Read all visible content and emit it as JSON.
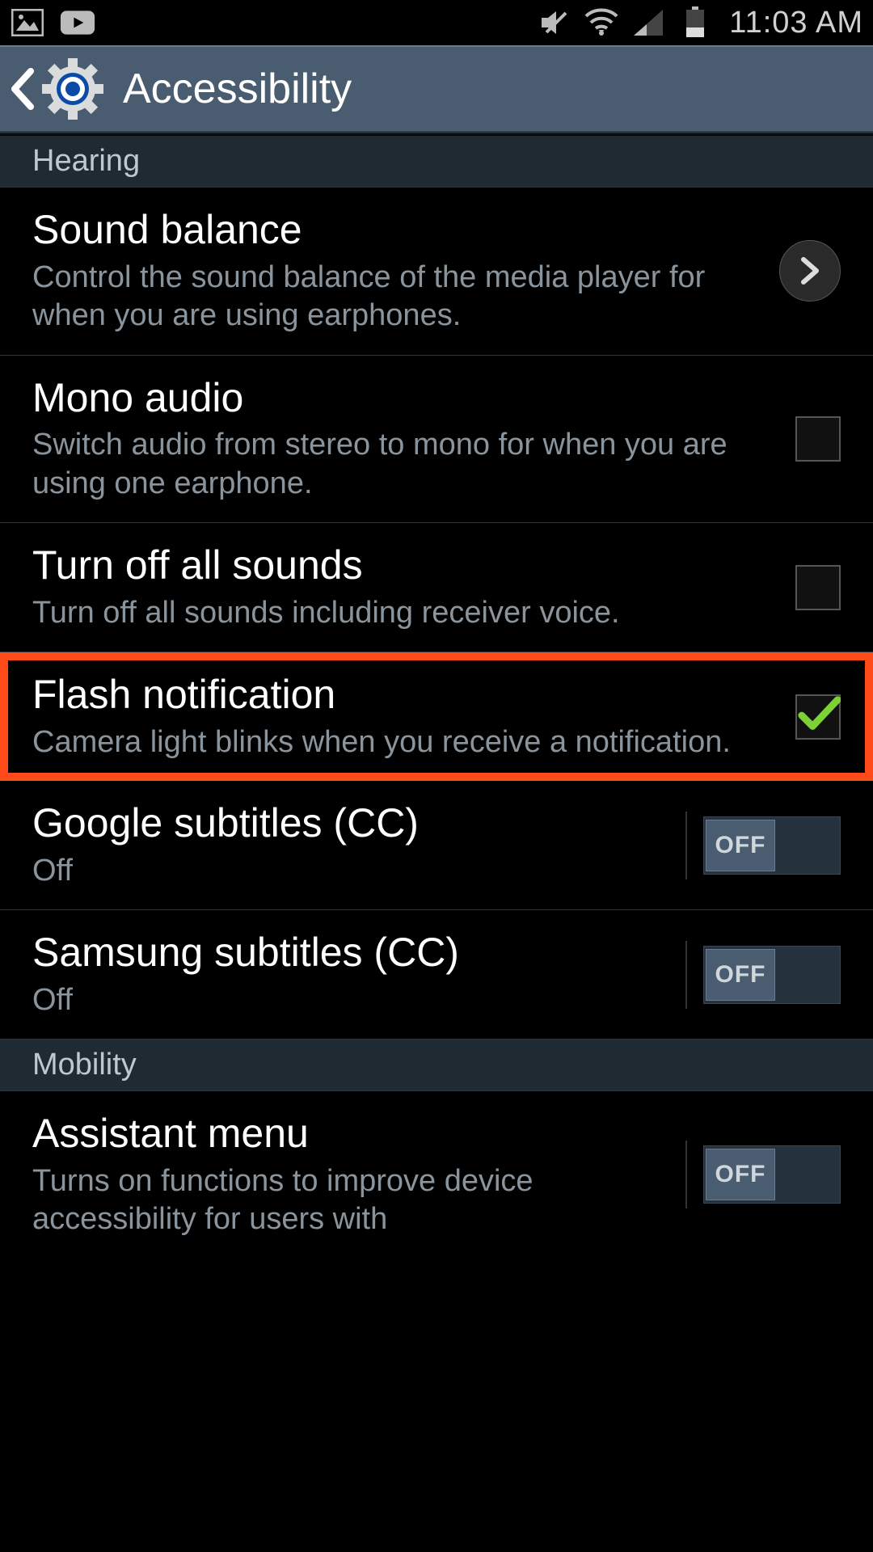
{
  "status_bar": {
    "time": "11:03 AM",
    "icons_left": [
      "picture-icon",
      "youtube-icon"
    ],
    "icons_right": [
      "mute-icon",
      "wifi-icon",
      "signal-icon",
      "battery-icon"
    ]
  },
  "action_bar": {
    "title": "Accessibility"
  },
  "sections": [
    {
      "header": "Hearing",
      "items": [
        {
          "key": "sound-balance",
          "title": "Sound balance",
          "desc": "Control the sound balance of the media player for when you are using earphones.",
          "accessory": "chevron"
        },
        {
          "key": "mono-audio",
          "title": "Mono audio",
          "desc": "Switch audio from stereo to mono for when you are using one earphone.",
          "accessory": "checkbox",
          "checked": false
        },
        {
          "key": "turn-off-all-sounds",
          "title": "Turn off all sounds",
          "desc": "Turn off all sounds including receiver voice.",
          "accessory": "checkbox",
          "checked": false
        },
        {
          "key": "flash-notification",
          "title": "Flash notification",
          "desc": "Camera light blinks when you receive a notification.",
          "accessory": "checkbox",
          "checked": true,
          "highlighted": true
        },
        {
          "key": "google-subtitles",
          "title": "Google subtitles (CC)",
          "desc": "Off",
          "accessory": "toggle",
          "toggle_label": "OFF"
        },
        {
          "key": "samsung-subtitles",
          "title": "Samsung subtitles (CC)",
          "desc": "Off",
          "accessory": "toggle",
          "toggle_label": "OFF"
        }
      ]
    },
    {
      "header": "Mobility",
      "items": [
        {
          "key": "assistant-menu",
          "title": "Assistant menu",
          "desc": "Turns on functions to improve device accessibility for users with",
          "accessory": "toggle",
          "toggle_label": "OFF"
        }
      ]
    }
  ]
}
